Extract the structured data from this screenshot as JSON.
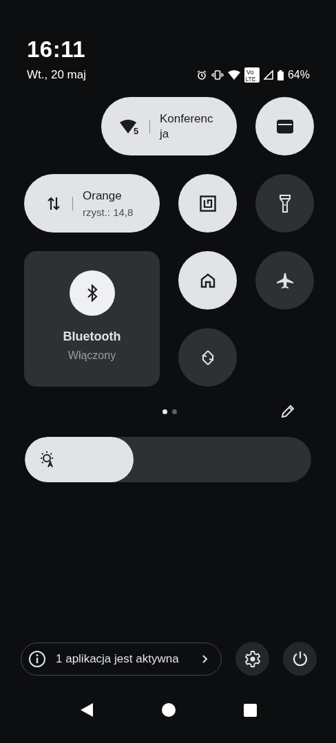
{
  "header": {
    "time": "16:11",
    "date": "Wt., 20 maj",
    "volte": [
      "Vo",
      "LTE"
    ],
    "battery_text": "64%"
  },
  "tiles": [
    {
      "kind": "wide",
      "on": true,
      "label": "Konferencja",
      "badge": "5"
    },
    {
      "kind": "round",
      "on": true
    },
    {
      "kind": "wide",
      "on": true,
      "label": "Orange",
      "secondary": "rzyst.: 14,8"
    },
    {
      "kind": "round",
      "on": true
    },
    {
      "kind": "round",
      "on": false
    },
    {
      "kind": "large",
      "on": true,
      "label": "Bluetooth",
      "secondary": "Włączony"
    },
    {
      "kind": "round",
      "on": true
    },
    {
      "kind": "round",
      "on": false
    },
    {
      "kind": "round",
      "on": false
    }
  ],
  "pages": [
    {
      "selected": true
    },
    {
      "selected": false
    }
  ],
  "brightness": {
    "level": 0.38
  },
  "footer": {
    "active_apps": "1 aplikacja jest aktywna"
  }
}
